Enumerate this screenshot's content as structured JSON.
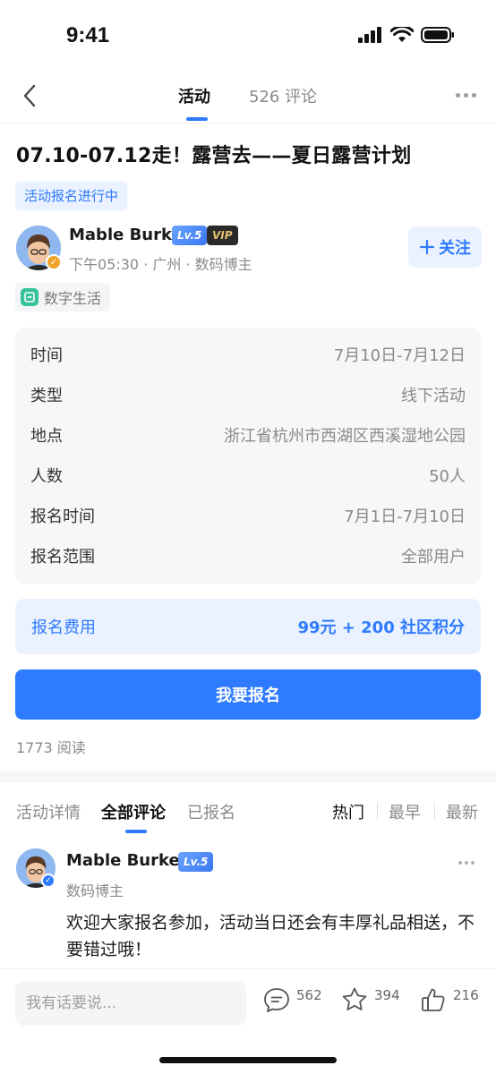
{
  "status_bar": {
    "time": "9:41"
  },
  "nav": {
    "tab_active": "活动",
    "tab_comments": "526 评论"
  },
  "post": {
    "title": "07.10-07.12走！露营去——夏日露营计划",
    "status_tag": "活动报名进行中",
    "author": {
      "name": "Mable Burke",
      "level": "Lv.5",
      "vip": "VIP",
      "meta": "下午05:30 · 广州 · 数码博主"
    },
    "follow_label": "关注",
    "topic": "数字生活"
  },
  "info": {
    "rows": [
      {
        "key": "时间",
        "value": "7月10日-7月12日"
      },
      {
        "key": "类型",
        "value": "线下活动"
      },
      {
        "key": "地点",
        "value": "浙江省杭州市西湖区西溪湿地公园"
      },
      {
        "key": "人数",
        "value": "50人"
      },
      {
        "key": "报名时间",
        "value": "7月1日-7月10日"
      },
      {
        "key": "报名范围",
        "value": "全部用户"
      }
    ]
  },
  "fee": {
    "label": "报名费用",
    "value": "99元 +  200 社区积分"
  },
  "signup_label": "我要报名",
  "read_count": "1773 阅读",
  "sub_tabs": {
    "details": "活动详情",
    "all_comments": "全部评论",
    "registered": "已报名",
    "sort_hot": "热门",
    "sort_earliest": "最早",
    "sort_latest": "最新"
  },
  "comment": {
    "name": "Mable Burke",
    "level": "Lv.5",
    "role": "数码博主",
    "text": "欢迎大家报名参加，活动当日还会有丰厚礼品相送，不要错过哦！"
  },
  "bottom": {
    "input_placeholder": "我有话要说...",
    "comments_count": "562",
    "favorites_count": "394",
    "likes_count": "216"
  },
  "colors": {
    "accent": "#2f7bff",
    "accent_light": "#eaf2ff"
  }
}
